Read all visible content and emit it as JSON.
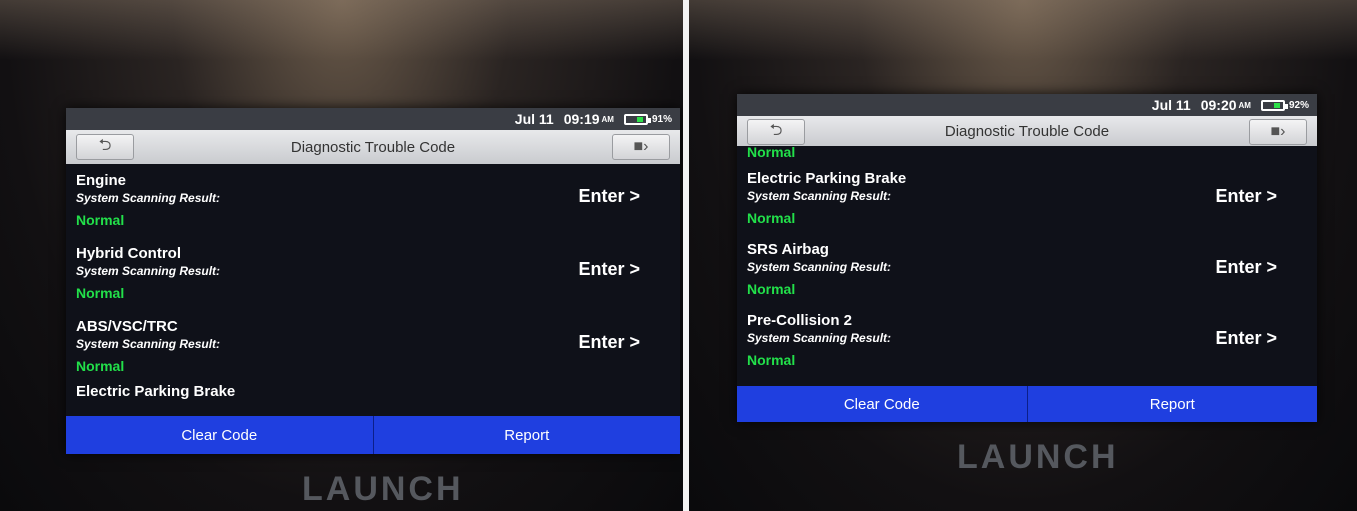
{
  "brand": "LAUNCH",
  "colors": {
    "normal": "#22e04a",
    "action": "#1f3fe0",
    "titlebar": "#d8d9dc",
    "battery": "#2ee04a"
  },
  "left": {
    "status": {
      "date": "Jul 11",
      "time": "09:19",
      "ampm": "AM",
      "battery": "91%"
    },
    "title": "Diagnostic Trouble Code",
    "systems": [
      {
        "name": "Engine",
        "label": "System Scanning Result:",
        "status": "Normal",
        "enter": "Enter >"
      },
      {
        "name": "Hybrid Control",
        "label": "System Scanning Result:",
        "status": "Normal",
        "enter": "Enter >"
      },
      {
        "name": "ABS/VSC/TRC",
        "label": "System Scanning Result:",
        "status": "Normal",
        "enter": "Enter >"
      }
    ],
    "partial": "Electric Parking Brake",
    "buttons": {
      "clear": "Clear Code",
      "report": "Report"
    }
  },
  "right": {
    "status": {
      "date": "Jul 11",
      "time": "09:20",
      "ampm": "AM",
      "battery": "92%"
    },
    "title": "Diagnostic Trouble Code",
    "top_partial": "Normal",
    "systems": [
      {
        "name": "Electric Parking Brake",
        "label": "System Scanning Result:",
        "status": "Normal",
        "enter": "Enter >"
      },
      {
        "name": "SRS Airbag",
        "label": "System Scanning Result:",
        "status": "Normal",
        "enter": "Enter >"
      },
      {
        "name": "Pre-Collision 2",
        "label": "System Scanning Result:",
        "status": "Normal",
        "enter": "Enter >"
      }
    ],
    "buttons": {
      "clear": "Clear Code",
      "report": "Report"
    }
  },
  "icons": {
    "back": "back-arrow-icon",
    "exit": "exit-icon"
  }
}
